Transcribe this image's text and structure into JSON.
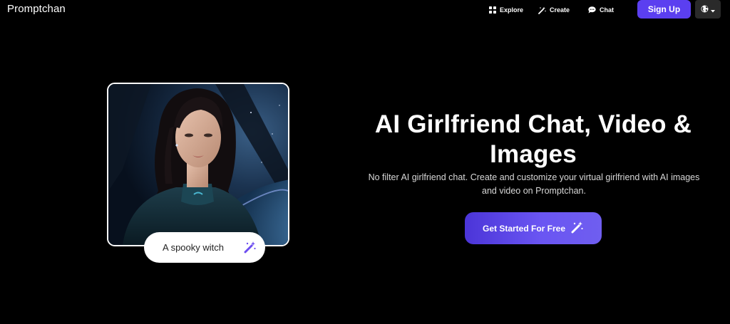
{
  "brand": {
    "name": "Promptchan"
  },
  "nav": {
    "items": [
      {
        "label": "Explore",
        "icon": "grid-icon"
      },
      {
        "label": "Create",
        "icon": "magic-wand-icon"
      },
      {
        "label": "Chat",
        "icon": "chat-bubble-icon"
      }
    ],
    "signup_label": "Sign Up",
    "language_icon": "globe-icon"
  },
  "hero": {
    "prompt_text": "A spooky witch",
    "title": "AI Girlfriend Chat, Video & Images",
    "subtitle": "No filter AI girlfriend chat. Create and customize your virtual girlfriend with AI images and video on Promptchan.",
    "cta_label": "Get Started For Free"
  },
  "colors": {
    "background": "#000000",
    "accent": "#5b3ff0",
    "cta_gradient_start": "#4b35d8",
    "cta_gradient_end": "#6f5ef0"
  }
}
